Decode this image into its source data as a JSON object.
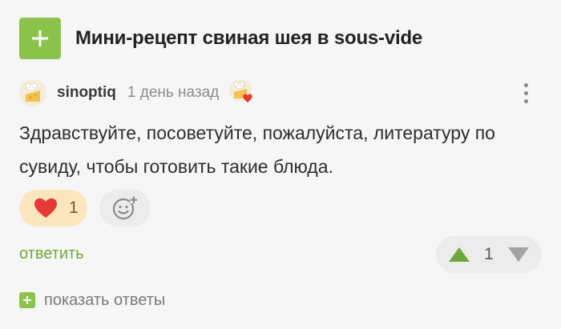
{
  "post": {
    "title": "Мини-рецепт свиная шея в sous-vide",
    "add_icon": "plus-icon"
  },
  "comment": {
    "username": "sinoptiq",
    "time_ago": "1 день назад",
    "avatar_icon": "cheese-chef-avatar",
    "badge_icon": "cheese-chef-heart-badge",
    "menu_icon": "kebab-menu-icon",
    "text": "Здравствуйте, посоветуйте, пожалуйста, литературу по сувиду, чтобы готовить такие блюда."
  },
  "reactions": {
    "like_icon": "heart-icon",
    "like_count": "1",
    "add_reaction_icon": "smiley-plus-icon"
  },
  "actions": {
    "reply_label": "ответить",
    "rating": "1",
    "upvote_icon": "triangle-up-icon",
    "downvote_icon": "triangle-down-icon",
    "show_replies_label": "показать ответы"
  },
  "colors": {
    "brand_green": "#8bc34a",
    "like_bg": "#fbe6bd",
    "heart_red": "#e53935",
    "link_green": "#6fa83a",
    "pill_gray": "#ececec"
  }
}
